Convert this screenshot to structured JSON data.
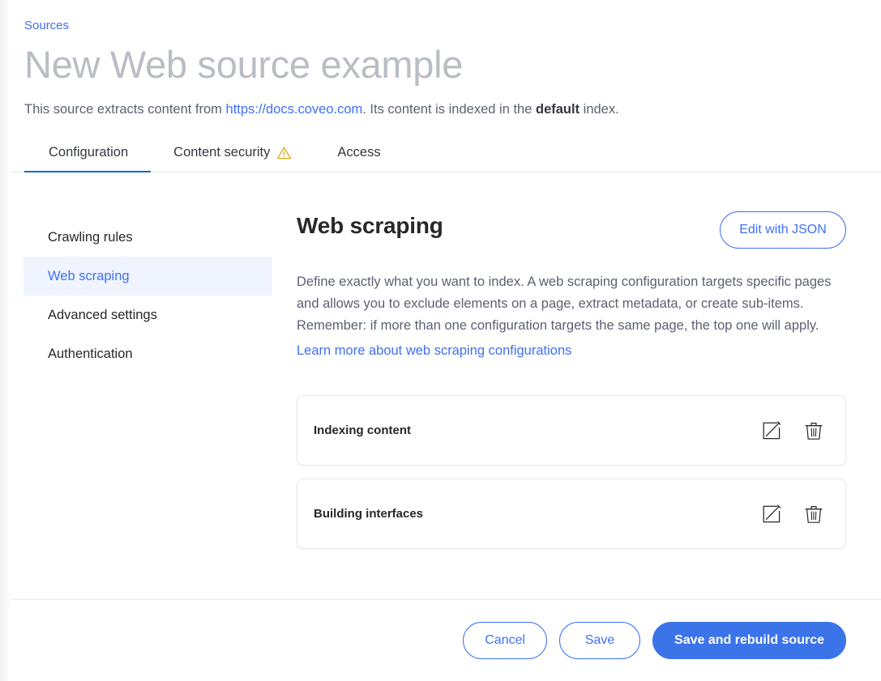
{
  "header": {
    "breadcrumb": "Sources",
    "title": "New Web source example",
    "subtitle_part1": "This source extracts content from ",
    "subtitle_link": "https://docs.coveo.com",
    "subtitle_part2": ". Its content is indexed in the ",
    "subtitle_bold": "default",
    "subtitle_part3": " index."
  },
  "tabs": [
    {
      "label": "Configuration",
      "active": true,
      "warning": false
    },
    {
      "label": "Content security",
      "active": false,
      "warning": true,
      "warning_icon": "warning-triangle-icon"
    },
    {
      "label": "Access",
      "active": false,
      "warning": false
    }
  ],
  "sidebar": {
    "items": [
      {
        "label": "Crawling rules",
        "selected": false
      },
      {
        "label": "Web scraping",
        "selected": true
      },
      {
        "label": "Advanced settings",
        "selected": false
      },
      {
        "label": "Authentication",
        "selected": false
      }
    ]
  },
  "main": {
    "section_title": "Web scraping",
    "json_button": "Edit with JSON",
    "description_line1": "Define exactly what you want to index. A web scraping configuration targets specific pages",
    "description_line2": "and allows you to exclude elements on a page, extract metadata, or create sub-items.",
    "description_line3": "Remember: if more than one configuration targets the same page, the top one will apply.",
    "learn_more": "Learn more about web scraping configurations",
    "configurations": [
      {
        "title": "Indexing content",
        "edit_icon": "edit-pencil-icon",
        "delete_icon": "trash-icon"
      },
      {
        "title": "Building interfaces",
        "edit_icon": "edit-pencil-icon",
        "delete_icon": "trash-icon"
      }
    ]
  },
  "footer": {
    "cancel": "Cancel",
    "save": "Save",
    "save_rebuild": "Save and rebuild source"
  },
  "colors": {
    "accent_blue": "#4070f4",
    "primary_button": "#3b74e8",
    "tab_underline": "#1565d8",
    "selected_bg": "#eff4fe",
    "warning_amber": "#d6a817",
    "title_gray": "#b9bdc4",
    "body_gray": "#5b6270",
    "border_gray": "#e5e8eb"
  }
}
